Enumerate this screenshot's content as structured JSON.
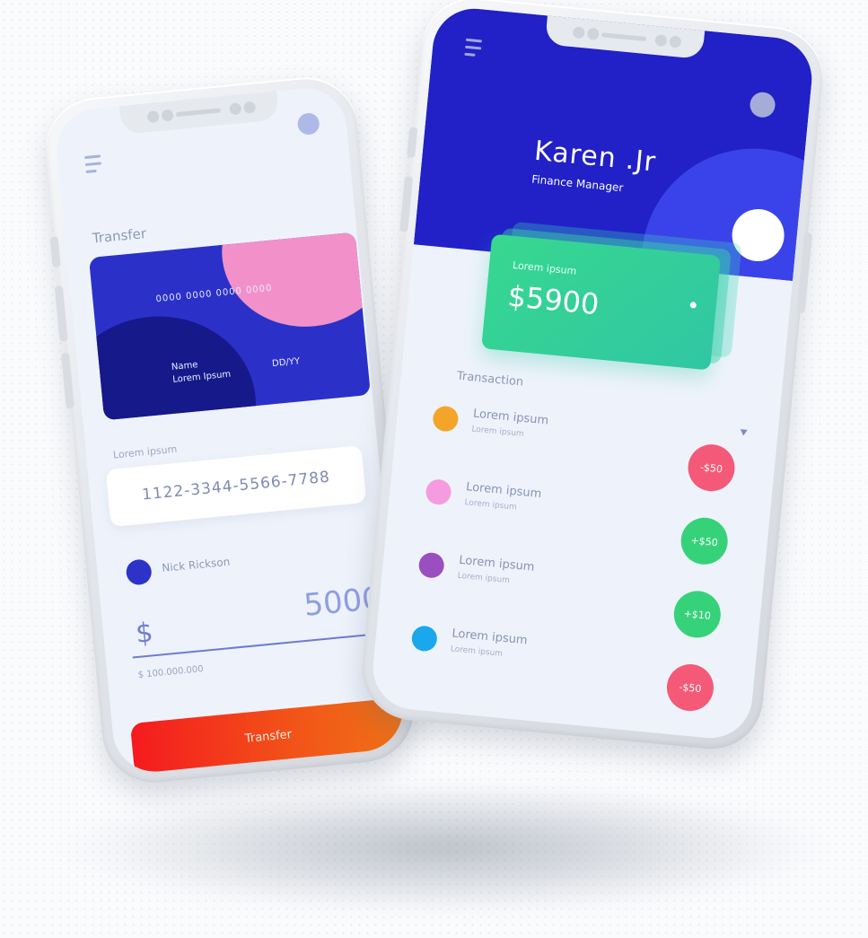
{
  "colors": {
    "primary_blue": "#2121c7",
    "card_pink": "#f291c9",
    "balance_green": "#37d88f",
    "transfer_red": "#f51a1f",
    "transfer_orange": "#f07316",
    "negative_badge": "#f45a78",
    "positive_badge": "#36d27a"
  },
  "transfer_screen": {
    "heading": "Transfer",
    "card": {
      "number": "0000 0000 0000 0000",
      "name_label": "Name",
      "name_value": "Lorem Ipsum",
      "expiry": "DD/YY"
    },
    "account_label": "Lorem ipsum",
    "account_number": "1122-3344-5566-7788",
    "recipient_name": "Nick Rickson",
    "currency_symbol": "$",
    "amount": "5000",
    "limit": "$ 100.000.000",
    "button_label": "Transfer"
  },
  "profile_screen": {
    "user_name": "Karen .Jr",
    "user_role": "Finance Manager",
    "balance_label": "Lorem ipsum",
    "balance_value": "$5900",
    "transaction_heading": "Transaction",
    "transactions": [
      {
        "title": "Lorem ipsum",
        "subtitle": "Lorem ipsum",
        "amount": "-$50",
        "dot_color": "#f3a52a",
        "kind": "neg"
      },
      {
        "title": "Lorem ipsum",
        "subtitle": "Lorem ipsum",
        "amount": "+$50",
        "dot_color": "#f59be0",
        "kind": "pos"
      },
      {
        "title": "Lorem ipsum",
        "subtitle": "Lorem ipsum",
        "amount": "+$10",
        "dot_color": "#9b4fbf",
        "kind": "pos"
      },
      {
        "title": "Lorem ipsum",
        "subtitle": "Lorem ipsum",
        "amount": "-$50",
        "dot_color": "#1aa7ec",
        "kind": "neg"
      }
    ]
  }
}
